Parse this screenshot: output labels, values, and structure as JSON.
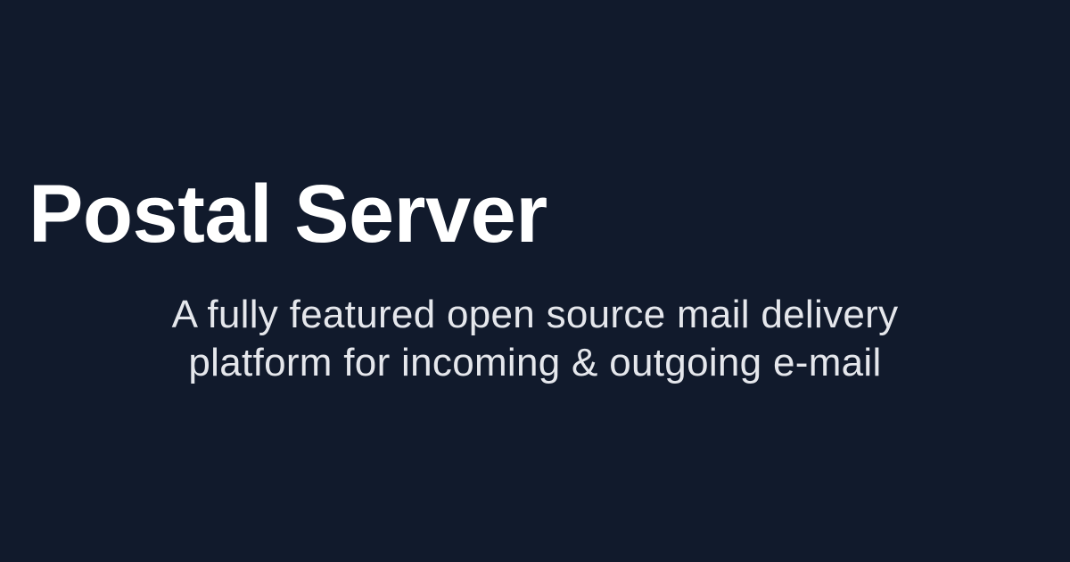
{
  "heading": {
    "title": "Postal Server"
  },
  "tagline": {
    "line1": "A fully featured open source mail delivery",
    "line2": "platform for incoming & outgoing e-mail"
  },
  "colors": {
    "background": "#111a2c",
    "title": "#ffffff",
    "tagline": "#e5e7ec"
  }
}
